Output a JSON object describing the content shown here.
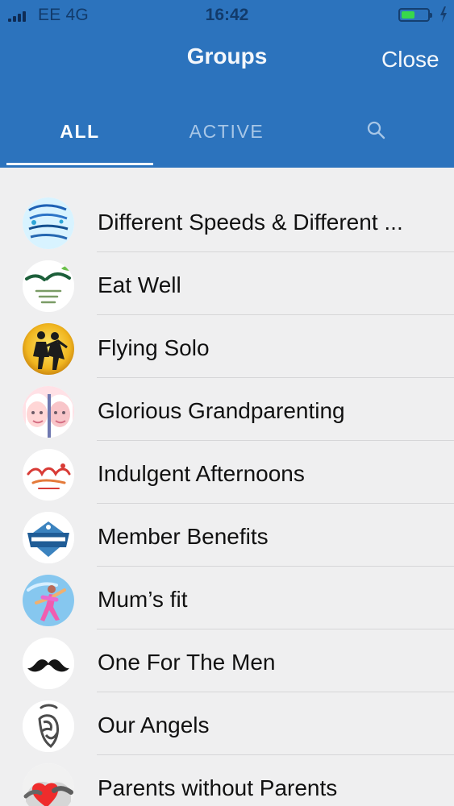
{
  "status_bar": {
    "carrier": "EE  4G",
    "time": "16:42",
    "battery_level": 0.5
  },
  "navigation": {
    "title": "Groups",
    "close_label": "Close"
  },
  "tabs": [
    {
      "label": "ALL",
      "selected": true
    },
    {
      "label": "ACTIVE",
      "selected": false
    },
    {
      "label": "",
      "icon": "search-icon",
      "selected": false
    }
  ],
  "groups": [
    {
      "name": "Different Speeds & Different ...",
      "icon": "different-speeds-logo-icon"
    },
    {
      "name": "Eat Well",
      "icon": "eat-well-logo-icon"
    },
    {
      "name": "Flying Solo",
      "icon": "flying-solo-silhouettes-icon"
    },
    {
      "name": "Glorious Grandparenting",
      "icon": "grandparents-faces-icon"
    },
    {
      "name": "Indulgent Afternoons",
      "icon": "indulgent-afternoons-logo-icon"
    },
    {
      "name": "Member Benefits",
      "icon": "member-badge-icon"
    },
    {
      "name": "Mum’s fit",
      "icon": "mums-fit-figure-icon"
    },
    {
      "name": "One For The Men",
      "icon": "moustache-icon"
    },
    {
      "name": "Our Angels",
      "icon": "angel-icon"
    },
    {
      "name": "Parents without Parents",
      "icon": "heart-hand-icon"
    }
  ],
  "colors": {
    "header": "#2c73bd",
    "list_background": "#efeff0",
    "text": "#111111",
    "tab_inactive": "#a8c7e7",
    "battery": "#38d84b"
  }
}
